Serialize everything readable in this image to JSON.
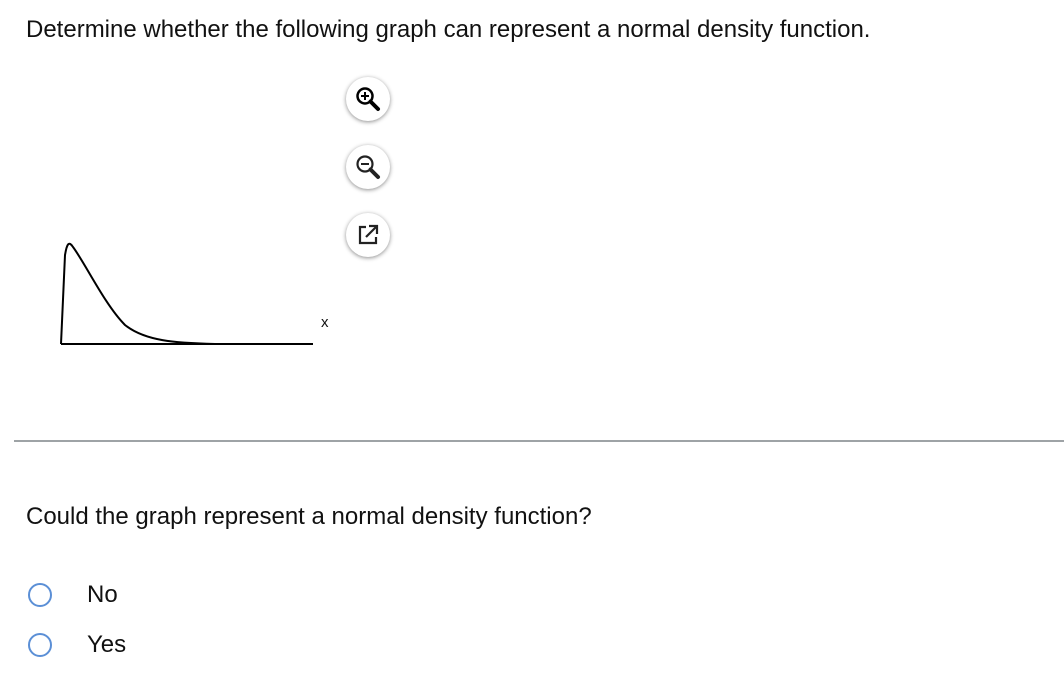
{
  "question": {
    "prompt": "Determine whether the following graph can represent a normal density function.",
    "sub_question": "Could the graph represent a normal density function?"
  },
  "graph": {
    "axis_label": "x",
    "description_shape": "right-skewed density curve"
  },
  "toolbar": {
    "zoom_in_icon": "zoom-in-icon",
    "zoom_out_icon": "zoom-out-icon",
    "popout_icon": "popout-icon"
  },
  "options": [
    {
      "label": "No",
      "selected": false
    },
    {
      "label": "Yes",
      "selected": false
    }
  ],
  "colors": {
    "radio_border": "#5b8fd6",
    "divider": "#9ea3a6"
  }
}
